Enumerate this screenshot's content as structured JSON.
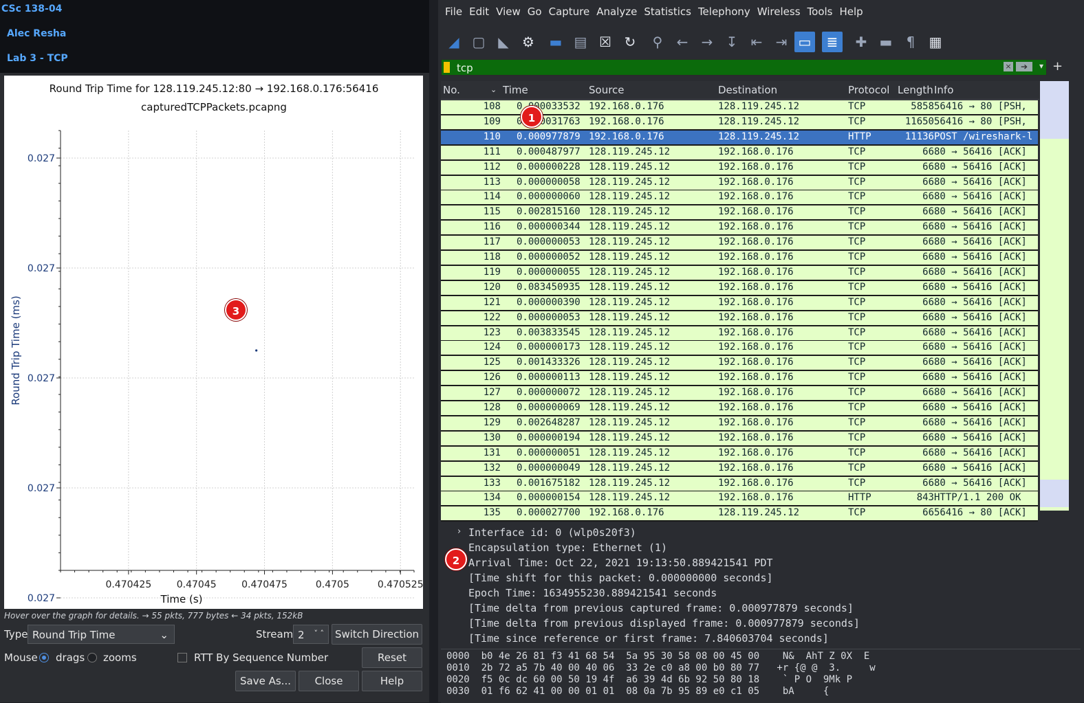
{
  "terminal": {
    "line1": "CSc 138-04",
    "line2": "Alec Resha",
    "line3": "Lab 3 - TCP"
  },
  "rtt_dialog": {
    "title": "Round Trip Time for 128.119.245.12:80 → 192.168.0.176:56416",
    "subtitle": "capturedTCPPackets.pcapng",
    "hint": "Hover over the graph for details. → 55 pkts, 777 bytes ← 34 pkts, 152kB",
    "type_label": "Type",
    "type_value": "Round Trip Time",
    "stream_label": "Stream",
    "stream_value": "2",
    "switch_direction": "Switch Direction",
    "mouse_label": "Mouse",
    "drags": "drags",
    "zooms": "zooms",
    "rtt_by_seq": "RTT By Sequence Number",
    "reset": "Reset",
    "save_as": "Save As...",
    "close": "Close",
    "help": "Help",
    "badge": "3"
  },
  "chart_data": {
    "type": "scatter",
    "title": "Round Trip Time for 128.119.245.12:80 → 192.168.0.176:56416",
    "subtitle": "capturedTCPPackets.pcapng",
    "xlabel": "Time (s)",
    "ylabel": "Round Trip Time (ms)",
    "x_ticks": [
      "0.470425",
      "0.47045",
      "0.470475",
      "0.4705",
      "0.470525"
    ],
    "y_ticks": [
      "0.027",
      "0.027",
      "0.027",
      "0.027",
      "0.027"
    ],
    "xlim": [
      0.4704,
      0.47053
    ],
    "ylim": [
      0.0266,
      0.0274
    ],
    "grid": true,
    "points": [
      {
        "x": 0.470472,
        "y": 0.027
      }
    ]
  },
  "wireshark": {
    "menu": [
      "File",
      "Edit",
      "View",
      "Go",
      "Capture",
      "Analyze",
      "Statistics",
      "Telephony",
      "Wireless",
      "Tools",
      "Help"
    ],
    "filter": "tcp",
    "columns": [
      "No.",
      "Time",
      "Source",
      "Destination",
      "Protocol",
      "Length",
      "Info"
    ],
    "packets": [
      {
        "no": "108",
        "time": "0.000033532",
        "src": "192.168.0.176",
        "dst": "128.119.245.12",
        "proto": "TCP",
        "len": "5858",
        "info": "56416 → 80 [PSH,"
      },
      {
        "no": "109",
        "time": "0.000031763",
        "src": "192.168.0.176",
        "dst": "128.119.245.12",
        "proto": "TCP",
        "len": "11650",
        "info": "56416 → 80 [PSH,"
      },
      {
        "no": "110",
        "time": "0.000977879",
        "src": "192.168.0.176",
        "dst": "128.119.245.12",
        "proto": "HTTP",
        "len": "11136",
        "info": "POST /wireshark-l"
      },
      {
        "no": "111",
        "time": "0.000487977",
        "src": "128.119.245.12",
        "dst": "192.168.0.176",
        "proto": "TCP",
        "len": "66",
        "info": "80 → 56416 [ACK]"
      },
      {
        "no": "112",
        "time": "0.000000228",
        "src": "128.119.245.12",
        "dst": "192.168.0.176",
        "proto": "TCP",
        "len": "66",
        "info": "80 → 56416 [ACK]"
      },
      {
        "no": "113",
        "time": "0.000000058",
        "src": "128.119.245.12",
        "dst": "192.168.0.176",
        "proto": "TCP",
        "len": "66",
        "info": "80 → 56416 [ACK]"
      },
      {
        "no": "114",
        "time": "0.000000060",
        "src": "128.119.245.12",
        "dst": "192.168.0.176",
        "proto": "TCP",
        "len": "66",
        "info": "80 → 56416 [ACK]"
      },
      {
        "no": "115",
        "time": "0.002815160",
        "src": "128.119.245.12",
        "dst": "192.168.0.176",
        "proto": "TCP",
        "len": "66",
        "info": "80 → 56416 [ACK]"
      },
      {
        "no": "116",
        "time": "0.000000344",
        "src": "128.119.245.12",
        "dst": "192.168.0.176",
        "proto": "TCP",
        "len": "66",
        "info": "80 → 56416 [ACK]"
      },
      {
        "no": "117",
        "time": "0.000000053",
        "src": "128.119.245.12",
        "dst": "192.168.0.176",
        "proto": "TCP",
        "len": "66",
        "info": "80 → 56416 [ACK]"
      },
      {
        "no": "118",
        "time": "0.000000052",
        "src": "128.119.245.12",
        "dst": "192.168.0.176",
        "proto": "TCP",
        "len": "66",
        "info": "80 → 56416 [ACK]"
      },
      {
        "no": "119",
        "time": "0.000000055",
        "src": "128.119.245.12",
        "dst": "192.168.0.176",
        "proto": "TCP",
        "len": "66",
        "info": "80 → 56416 [ACK]"
      },
      {
        "no": "120",
        "time": "0.083450935",
        "src": "128.119.245.12",
        "dst": "192.168.0.176",
        "proto": "TCP",
        "len": "66",
        "info": "80 → 56416 [ACK]"
      },
      {
        "no": "121",
        "time": "0.000000390",
        "src": "128.119.245.12",
        "dst": "192.168.0.176",
        "proto": "TCP",
        "len": "66",
        "info": "80 → 56416 [ACK]"
      },
      {
        "no": "122",
        "time": "0.000000053",
        "src": "128.119.245.12",
        "dst": "192.168.0.176",
        "proto": "TCP",
        "len": "66",
        "info": "80 → 56416 [ACK]"
      },
      {
        "no": "123",
        "time": "0.003833545",
        "src": "128.119.245.12",
        "dst": "192.168.0.176",
        "proto": "TCP",
        "len": "66",
        "info": "80 → 56416 [ACK]"
      },
      {
        "no": "124",
        "time": "0.000000173",
        "src": "128.119.245.12",
        "dst": "192.168.0.176",
        "proto": "TCP",
        "len": "66",
        "info": "80 → 56416 [ACK]"
      },
      {
        "no": "125",
        "time": "0.001433326",
        "src": "128.119.245.12",
        "dst": "192.168.0.176",
        "proto": "TCP",
        "len": "66",
        "info": "80 → 56416 [ACK]"
      },
      {
        "no": "126",
        "time": "0.000000113",
        "src": "128.119.245.12",
        "dst": "192.168.0.176",
        "proto": "TCP",
        "len": "66",
        "info": "80 → 56416 [ACK]"
      },
      {
        "no": "127",
        "time": "0.000000072",
        "src": "128.119.245.12",
        "dst": "192.168.0.176",
        "proto": "TCP",
        "len": "66",
        "info": "80 → 56416 [ACK]"
      },
      {
        "no": "128",
        "time": "0.000000069",
        "src": "128.119.245.12",
        "dst": "192.168.0.176",
        "proto": "TCP",
        "len": "66",
        "info": "80 → 56416 [ACK]"
      },
      {
        "no": "129",
        "time": "0.002648287",
        "src": "128.119.245.12",
        "dst": "192.168.0.176",
        "proto": "TCP",
        "len": "66",
        "info": "80 → 56416 [ACK]"
      },
      {
        "no": "130",
        "time": "0.000000194",
        "src": "128.119.245.12",
        "dst": "192.168.0.176",
        "proto": "TCP",
        "len": "66",
        "info": "80 → 56416 [ACK]"
      },
      {
        "no": "131",
        "time": "0.000000051",
        "src": "128.119.245.12",
        "dst": "192.168.0.176",
        "proto": "TCP",
        "len": "66",
        "info": "80 → 56416 [ACK]"
      },
      {
        "no": "132",
        "time": "0.000000049",
        "src": "128.119.245.12",
        "dst": "192.168.0.176",
        "proto": "TCP",
        "len": "66",
        "info": "80 → 56416 [ACK]"
      },
      {
        "no": "133",
        "time": "0.001675182",
        "src": "128.119.245.12",
        "dst": "192.168.0.176",
        "proto": "TCP",
        "len": "66",
        "info": "80 → 56416 [ACK]"
      },
      {
        "no": "134",
        "time": "0.000000154",
        "src": "128.119.245.12",
        "dst": "192.168.0.176",
        "proto": "HTTP",
        "len": "843",
        "info": "HTTP/1.1 200 OK"
      },
      {
        "no": "135",
        "time": "0.000027700",
        "src": "192.168.0.176",
        "dst": "128.119.245.12",
        "proto": "TCP",
        "len": "66",
        "info": "56416 → 80 [ACK]"
      }
    ],
    "selected_no": "110",
    "details": [
      "Interface id: 0 (wlp0s20f3)",
      "Encapsulation type: Ethernet (1)",
      "Arrival Time: Oct 22, 2021 19:13:50.889421541 PDT",
      "[Time shift for this packet: 0.000000000 seconds]",
      "Epoch Time: 1634955230.889421541 seconds",
      "[Time delta from previous captured frame: 0.000977879 seconds]",
      "[Time delta from previous displayed frame: 0.000977879 seconds]",
      "[Time since reference or first frame: 7.840603704 seconds]"
    ],
    "hex": [
      "0000  b0 4e 26 81 f3 41 68 54  5a 95 30 58 08 00 45 00    N&  AhT Z 0X  E",
      "0010  2b 72 a5 7b 40 00 40 06  33 2e c0 a8 00 b0 80 77   +r {@ @  3.     w",
      "0020  f5 0c dc 60 00 50 19 4f  a6 39 4d 6b 92 50 80 18    ` P O  9Mk P",
      "0030  01 f6 62 41 00 00 01 01  08 0a 7b 95 89 e0 c1 05    bA     {"
    ],
    "badge1": "1",
    "badge2": "2"
  }
}
